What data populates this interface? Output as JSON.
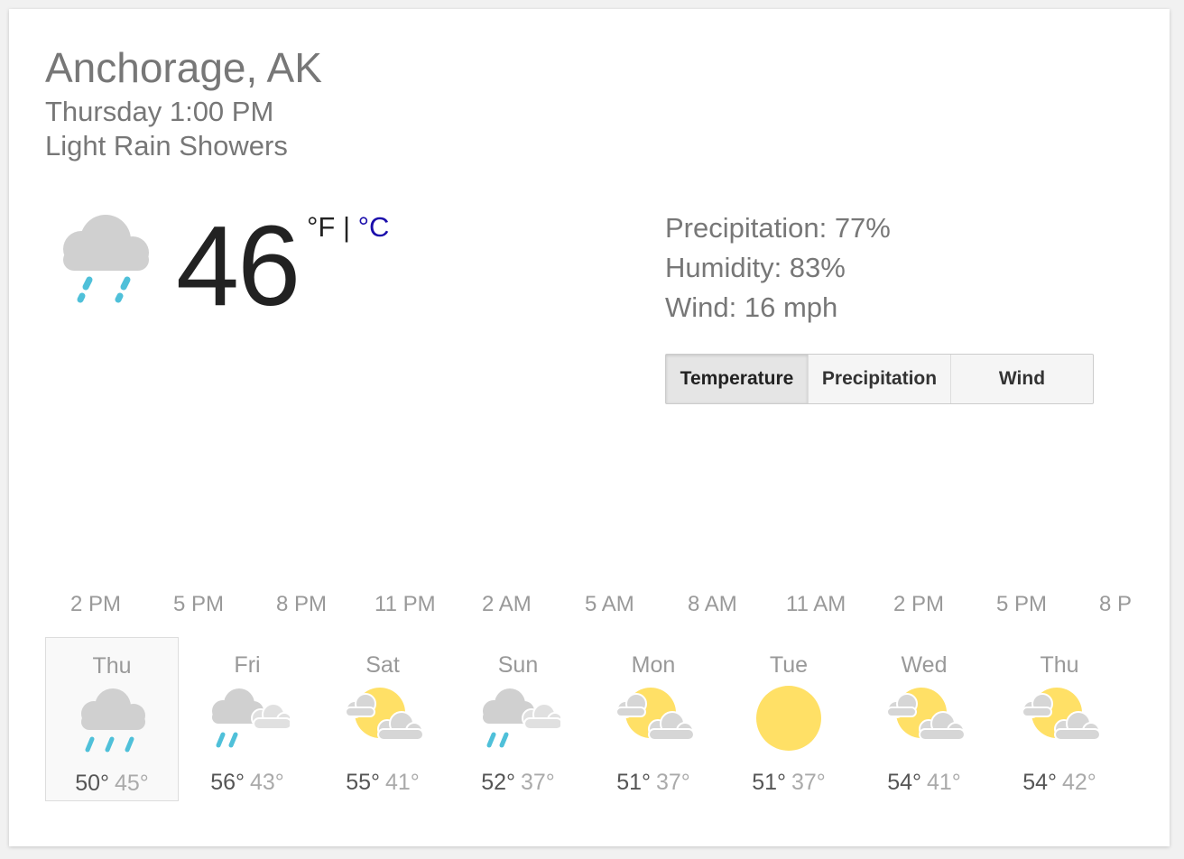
{
  "location": "Anchorage, AK",
  "datetime": "Thursday 1:00 PM",
  "condition": "Light Rain Showers",
  "current": {
    "temp": "46",
    "unit_f": "°F",
    "separator": "|",
    "unit_c": "°C",
    "icon": "rain-cloud-icon"
  },
  "details": {
    "precipitation": "Precipitation: 77%",
    "humidity": "Humidity: 83%",
    "wind": "Wind: 16 mph"
  },
  "tabs": [
    {
      "label": "Temperature",
      "active": true
    },
    {
      "label": "Precipitation",
      "active": false
    },
    {
      "label": "Wind",
      "active": false
    }
  ],
  "hours": [
    "2 PM",
    "5 PM",
    "8 PM",
    "11 PM",
    "2 AM",
    "5 AM",
    "8 AM",
    "11 AM",
    "2 PM",
    "5 PM",
    "8 P"
  ],
  "forecast": [
    {
      "day": "Thu",
      "hi": "50°",
      "lo": "45°",
      "icon": "rain-icon",
      "selected": true
    },
    {
      "day": "Fri",
      "hi": "56°",
      "lo": "43°",
      "icon": "rain-clouds-icon"
    },
    {
      "day": "Sat",
      "hi": "55°",
      "lo": "41°",
      "icon": "partly-cloudy-icon"
    },
    {
      "day": "Sun",
      "hi": "52°",
      "lo": "37°",
      "icon": "rain-clouds-icon"
    },
    {
      "day": "Mon",
      "hi": "51°",
      "lo": "37°",
      "icon": "partly-cloudy-icon"
    },
    {
      "day": "Tue",
      "hi": "51°",
      "lo": "37°",
      "icon": "sunny-icon"
    },
    {
      "day": "Wed",
      "hi": "54°",
      "lo": "41°",
      "icon": "partly-cloudy-icon"
    },
    {
      "day": "Thu",
      "hi": "54°",
      "lo": "42°",
      "icon": "partly-cloudy-icon"
    }
  ],
  "colors": {
    "cloud": "#d0d0d0",
    "rain": "#4fc0d9",
    "sun": "#ffe066",
    "link": "#1a0dab"
  }
}
